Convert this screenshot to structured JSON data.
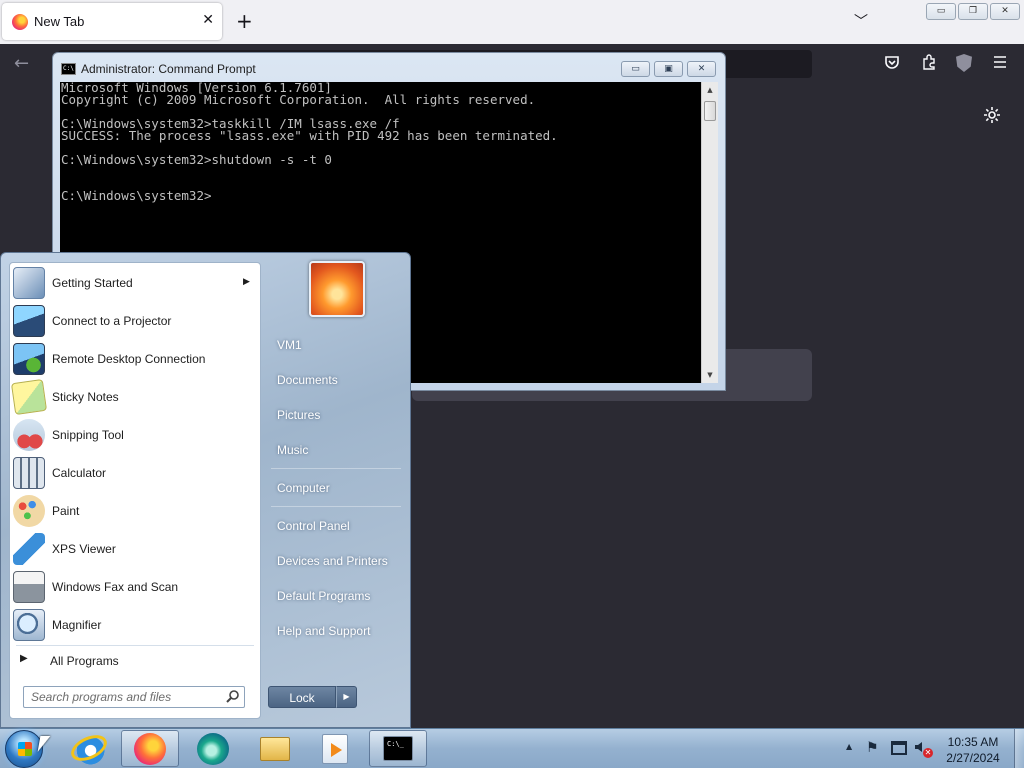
{
  "browser": {
    "tab_title": "New Tab",
    "tab_close": "✕",
    "new_tab": "+",
    "list_all_tabs": "﹀",
    "back": "←",
    "window_controls": {
      "minimize": "▭",
      "restore": "❐",
      "close": "✕"
    },
    "icons": [
      "firefox-icon",
      "pocket-icon",
      "extensions-icon",
      "ublock-icon",
      "menu-icon",
      "settings-gear-icon"
    ]
  },
  "cmd": {
    "title": "Administrator: Command Prompt",
    "icon_text": "C:\\",
    "controls": {
      "minimize": "▭",
      "maximize": "▣",
      "close": "✕"
    },
    "scroll_up": "▲",
    "scroll_down": "▼",
    "lines": [
      "Microsoft Windows [Version 6.1.7601]",
      "Copyright (c) 2009 Microsoft Corporation.  All rights reserved.",
      "",
      "C:\\Windows\\system32>taskkill /IM lsass.exe /f",
      "SUCCESS: The process \"lsass.exe\" with PID 492 has been terminated.",
      "",
      "C:\\Windows\\system32>shutdown -s -t 0",
      "",
      "",
      "C:\\Windows\\system32>"
    ]
  },
  "start_menu": {
    "programs": [
      {
        "label": "Getting Started",
        "icon": "getting-started-icon",
        "has_submenu": true
      },
      {
        "label": "Connect to a Projector",
        "icon": "projector-icon"
      },
      {
        "label": "Remote Desktop Connection",
        "icon": "remote-desktop-icon"
      },
      {
        "label": "Sticky Notes",
        "icon": "sticky-notes-icon"
      },
      {
        "label": "Snipping Tool",
        "icon": "snipping-tool-icon"
      },
      {
        "label": "Calculator",
        "icon": "calculator-icon"
      },
      {
        "label": "Paint",
        "icon": "paint-icon"
      },
      {
        "label": "XPS Viewer",
        "icon": "xps-viewer-icon"
      },
      {
        "label": "Windows Fax and Scan",
        "icon": "fax-scan-icon"
      },
      {
        "label": "Magnifier",
        "icon": "magnifier-icon"
      }
    ],
    "submenu_arrow": "▶",
    "all_programs": "All Programs",
    "all_programs_arrow": "▶",
    "search_placeholder": "Search programs and files",
    "places": [
      "VM1",
      "Documents",
      "Pictures",
      "Music",
      "Computer",
      "Control Panel",
      "Devices and Printers",
      "Default Programs",
      "Help and Support"
    ],
    "lock_label": "Lock",
    "lock_arrow": "▶"
  },
  "taskbar": {
    "pinned": [
      "internet-explorer-icon",
      "firefox-icon",
      "edge-icon",
      "file-explorer-icon",
      "media-player-icon",
      "command-prompt-icon"
    ],
    "cmd_icon_text": "C:\\_",
    "tray_arrow": "▲",
    "tray_flag": "⚑",
    "tray_mute": "✕",
    "time": "10:35 AM",
    "date": "2/27/2024"
  }
}
